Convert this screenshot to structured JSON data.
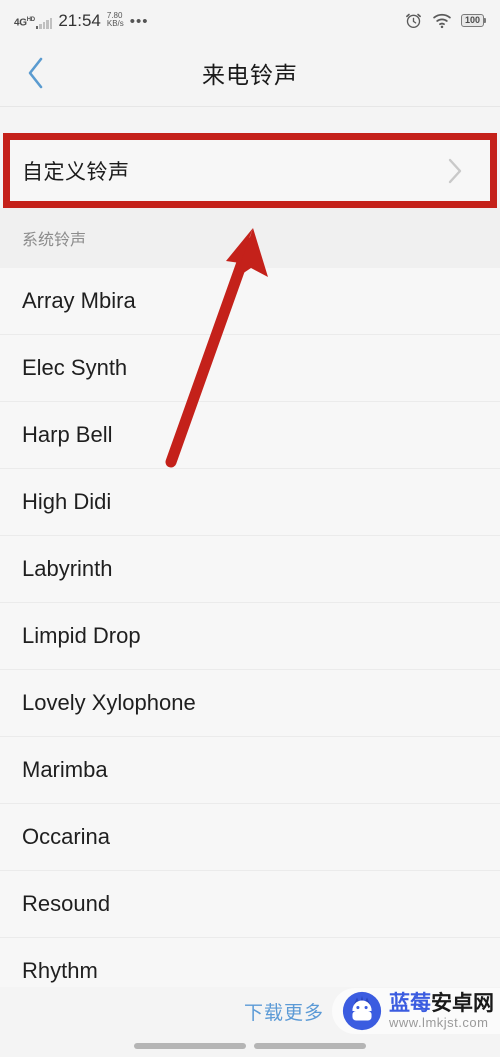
{
  "status_bar": {
    "network_type": "4G",
    "network_sup": "HD",
    "time": "21:54",
    "data_rate_value": "7.80",
    "data_rate_unit": "KB/s",
    "overflow_dots": "•••",
    "alarm_icon": "alarm-clock-icon",
    "wifi_icon": "wifi-icon",
    "battery_level": "100"
  },
  "header": {
    "back_icon": "chevron-left-icon",
    "title": "来电铃声"
  },
  "custom_ringtone": {
    "label": "自定义铃声",
    "chevron_icon": "chevron-right-icon",
    "highlight_color": "#c4211a"
  },
  "section": {
    "title": "系统铃声"
  },
  "ringtones": [
    {
      "name": "Array Mbira"
    },
    {
      "name": "Elec Synth"
    },
    {
      "name": "Harp Bell"
    },
    {
      "name": "High Didi"
    },
    {
      "name": "Labyrinth"
    },
    {
      "name": "Limpid Drop"
    },
    {
      "name": "Lovely Xylophone"
    },
    {
      "name": "Marimba"
    },
    {
      "name": "Occarina"
    },
    {
      "name": "Resound"
    },
    {
      "name": "Rhythm"
    }
  ],
  "bottom": {
    "download_more": "下载更多",
    "link_color": "#5b9ad6"
  },
  "watermark": {
    "logo_icon": "android-robot-icon",
    "brand_blue": "蓝莓",
    "brand_dark": "安卓网",
    "url": "www.lmkjst.com"
  },
  "annotation": {
    "arrow_icon": "red-arrow-icon",
    "arrow_color": "#c4211a"
  }
}
